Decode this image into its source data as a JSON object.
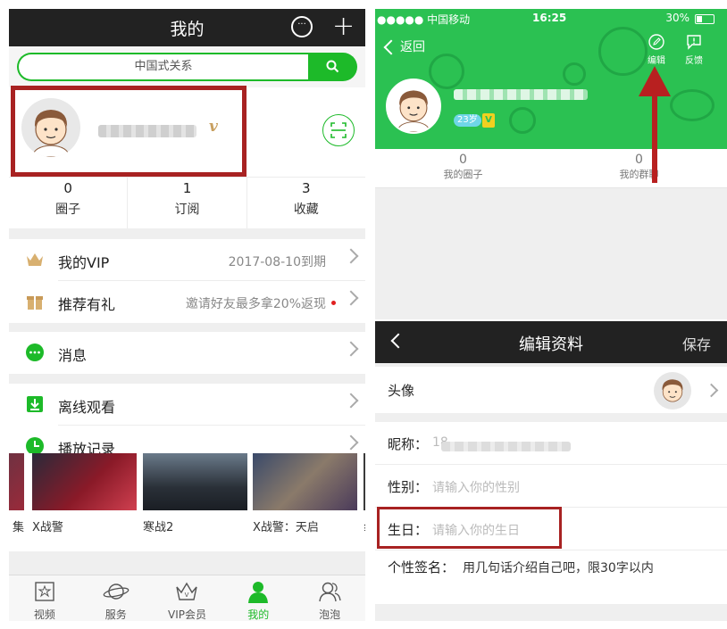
{
  "left": {
    "header": {
      "title": "我的"
    },
    "search": {
      "text": "中国式关系"
    },
    "profile": {
      "vip_mark": "v"
    },
    "stats": [
      {
        "num": "0",
        "label": "圈子"
      },
      {
        "num": "1",
        "label": "订阅"
      },
      {
        "num": "3",
        "label": "收藏"
      }
    ],
    "menu": [
      {
        "label": "我的VIP",
        "value": "2017-08-10到期"
      },
      {
        "label": "推荐有礼",
        "value": "邀请好友最多拿20%返现"
      },
      {
        "label": "消息",
        "value": ""
      },
      {
        "label": "离线观看",
        "value": ""
      },
      {
        "label": "播放记录",
        "value": ""
      }
    ],
    "movies": [
      "集",
      "X战警",
      "寒战2",
      "X战警：天启",
      "纟"
    ],
    "tabs": [
      {
        "label": "视频",
        "icon": "video-icon"
      },
      {
        "label": "服务",
        "icon": "planet-icon"
      },
      {
        "label": "VIP会员",
        "icon": "crown-icon"
      },
      {
        "label": "我的",
        "icon": "person-icon",
        "active": true
      },
      {
        "label": "泡泡",
        "icon": "people-icon"
      }
    ],
    "colors": {
      "green": "#1dba29",
      "header": "#222222"
    }
  },
  "right_top": {
    "status": {
      "carrier": "●●●●● 中国移动",
      "time": "16:25",
      "battery": "30%"
    },
    "back": "返回",
    "buttons": {
      "edit": "编辑",
      "feedback": "反馈"
    },
    "age": "23岁",
    "v": "V",
    "stats": [
      {
        "num": "0",
        "label": "我的圈子"
      },
      {
        "num": "0",
        "label": "我的群聊"
      }
    ],
    "colors": {
      "green": "#2bc152"
    }
  },
  "right_bottom": {
    "header": {
      "title": "编辑资料",
      "save": "保存"
    },
    "fields": {
      "avatar": "头像",
      "nickname": "昵称：",
      "nickname_prefix": "18",
      "gender": "性别：",
      "gender_placeholder": "请输入你的性别",
      "birthday": "生日：",
      "birthday_placeholder": "请输入你的生日",
      "signature": "个性签名：",
      "signature_placeholder": "用几句话介绍自己吧，限30字以内"
    }
  }
}
